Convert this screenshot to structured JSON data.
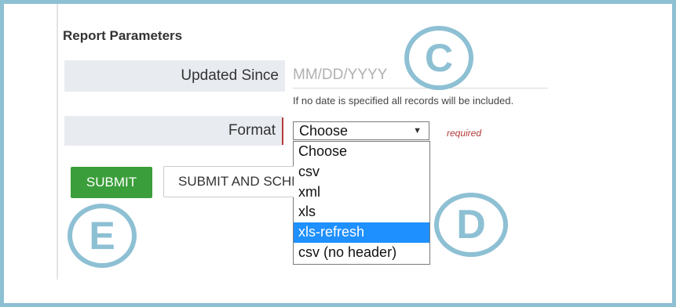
{
  "section_title": "Report Parameters",
  "updated_since": {
    "label": "Updated Since",
    "placeholder": "MM/DD/YYYY",
    "value": "",
    "help": "If no date is specified all records will be included."
  },
  "format": {
    "label": "Format",
    "selected": "Choose",
    "required_text": "required",
    "options": [
      "Choose",
      "csv",
      "xml",
      "xls",
      "xls-refresh",
      "csv (no header)"
    ],
    "highlighted_option": "xls-refresh"
  },
  "buttons": {
    "submit": "SUBMIT",
    "submit_schedule": "SUBMIT AND SCHEDULE"
  },
  "callouts": {
    "c": "C",
    "d": "D",
    "e": "E"
  },
  "colors": {
    "frame": "#8ec0d4",
    "submit_green": "#3a9e3a",
    "highlight_blue": "#1e90ff",
    "required_red": "#b33a3a"
  },
  "icons": {
    "select_arrow": "caret-down-icon"
  }
}
